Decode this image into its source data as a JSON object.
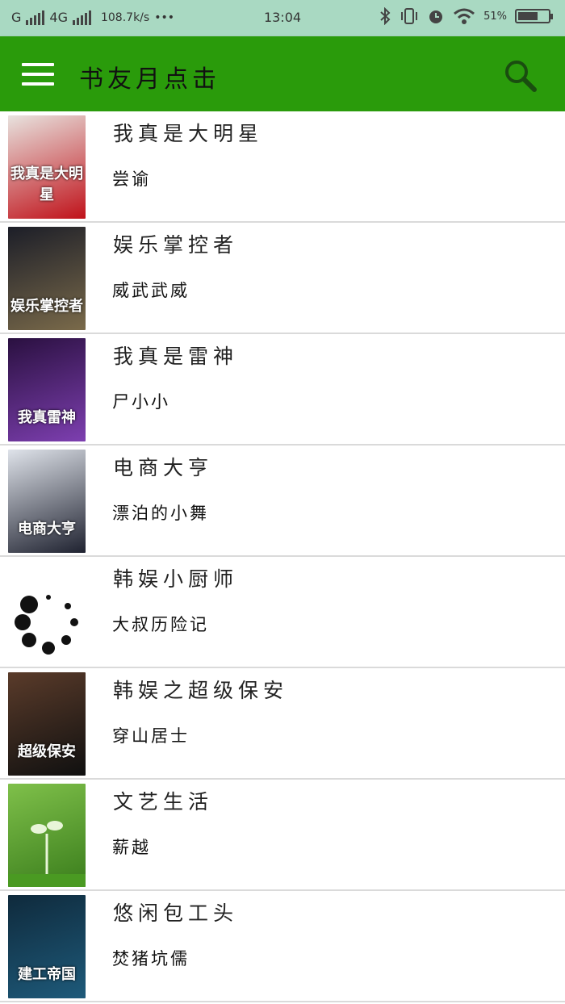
{
  "status_bar": {
    "left": "G",
    "network": "4G",
    "speed": "108.7k/s",
    "time": "13:04",
    "battery": "51%"
  },
  "app_bar": {
    "title": "书友月点击"
  },
  "books": [
    {
      "title": "我真是大明星",
      "author": "尝谕",
      "cover_text": "我真是大明星",
      "cover_colors": [
        "#e8e3df",
        "#c0121a"
      ]
    },
    {
      "title": "娱乐掌控者",
      "author": "威武武威",
      "cover_text": "娱乐掌控者",
      "cover_colors": [
        "#1c1e28",
        "#7a6a4a"
      ]
    },
    {
      "title": "我真是雷神",
      "author": "尸小小",
      "cover_text": "我真雷神",
      "cover_colors": [
        "#2a1040",
        "#7d3fb0"
      ]
    },
    {
      "title": "电商大亨",
      "author": "漂泊的小舞",
      "cover_text": "电商大亨",
      "cover_colors": [
        "#dfe3ea",
        "#1f2230"
      ]
    },
    {
      "title": "韩娱小厨师",
      "author": "大叔历险记",
      "cover_text": "",
      "cover_colors": [
        "#ffffff",
        "#ffffff"
      ],
      "loading": true
    },
    {
      "title": "韩娱之超级保安",
      "author": "穿山居士",
      "cover_text": "超级保安",
      "cover_colors": [
        "#5a3b2a",
        "#101010"
      ]
    },
    {
      "title": "文艺生活",
      "author": "薪越",
      "cover_text": "",
      "cover_colors": [
        "#7fc04a",
        "#3a7d1c"
      ]
    },
    {
      "title": "悠闲包工头",
      "author": "焚猪坑儒",
      "cover_text": "建工帝国",
      "cover_colors": [
        "#0f2a3c",
        "#1e5a7a"
      ]
    }
  ]
}
